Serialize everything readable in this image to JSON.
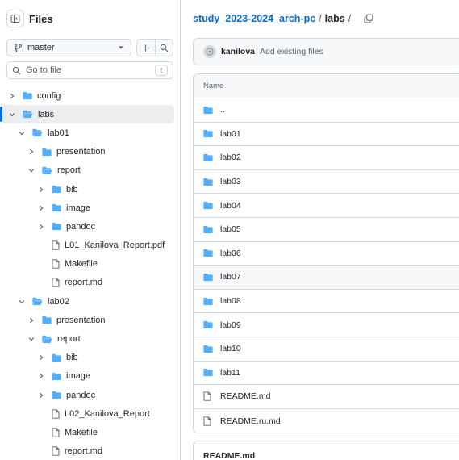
{
  "sidebar": {
    "title": "Files",
    "branch": "master",
    "search_placeholder": "Go to file",
    "search_shortcut": "t",
    "tree": [
      {
        "label": "config",
        "type": "folder",
        "depth": 0,
        "expanded": false
      },
      {
        "label": "labs",
        "type": "folder",
        "depth": 0,
        "expanded": true,
        "selected": true
      },
      {
        "label": "lab01",
        "type": "folder",
        "depth": 1,
        "expanded": true
      },
      {
        "label": "presentation",
        "type": "folder",
        "depth": 2,
        "expanded": false
      },
      {
        "label": "report",
        "type": "folder",
        "depth": 2,
        "expanded": true
      },
      {
        "label": "bib",
        "type": "folder",
        "depth": 3,
        "expanded": false
      },
      {
        "label": "image",
        "type": "folder",
        "depth": 3,
        "expanded": false
      },
      {
        "label": "pandoc",
        "type": "folder",
        "depth": 3,
        "expanded": false
      },
      {
        "label": "L01_Kanilova_Report.pdf",
        "type": "file",
        "depth": 3
      },
      {
        "label": "Makefile",
        "type": "file",
        "depth": 3
      },
      {
        "label": "report.md",
        "type": "file",
        "depth": 3
      },
      {
        "label": "lab02",
        "type": "folder",
        "depth": 1,
        "expanded": true
      },
      {
        "label": "presentation",
        "type": "folder",
        "depth": 2,
        "expanded": false
      },
      {
        "label": "report",
        "type": "folder",
        "depth": 2,
        "expanded": true
      },
      {
        "label": "bib",
        "type": "folder",
        "depth": 3,
        "expanded": false
      },
      {
        "label": "image",
        "type": "folder",
        "depth": 3,
        "expanded": false
      },
      {
        "label": "pandoc",
        "type": "folder",
        "depth": 3,
        "expanded": false
      },
      {
        "label": "L02_Kanilova_Report",
        "type": "file",
        "depth": 3
      },
      {
        "label": "Makefile",
        "type": "file",
        "depth": 3
      },
      {
        "label": "report.md",
        "type": "file",
        "depth": 3
      }
    ]
  },
  "breadcrumb": {
    "repo": "study_2023-2024_arch-pc",
    "separator": "/",
    "current": "labs",
    "trailing": "/"
  },
  "commit": {
    "author": "kanilova",
    "message": "Add existing files"
  },
  "files": {
    "column_name": "Name",
    "rows": [
      {
        "name": "..",
        "type": "folder"
      },
      {
        "name": "lab01",
        "type": "folder"
      },
      {
        "name": "lab02",
        "type": "folder"
      },
      {
        "name": "lab03",
        "type": "folder"
      },
      {
        "name": "lab04",
        "type": "folder"
      },
      {
        "name": "lab05",
        "type": "folder"
      },
      {
        "name": "lab06",
        "type": "folder"
      },
      {
        "name": "lab07",
        "type": "folder",
        "hover": true
      },
      {
        "name": "lab08",
        "type": "folder"
      },
      {
        "name": "lab09",
        "type": "folder"
      },
      {
        "name": "lab10",
        "type": "folder"
      },
      {
        "name": "lab11",
        "type": "folder"
      },
      {
        "name": "README.md",
        "type": "file"
      },
      {
        "name": "README.ru.md",
        "type": "file"
      }
    ]
  },
  "readme": {
    "title": "README.md"
  },
  "colors": {
    "accent": "#0969da",
    "folder": "#54aeff",
    "border": "#d1d9e0",
    "muted": "#59636e"
  }
}
